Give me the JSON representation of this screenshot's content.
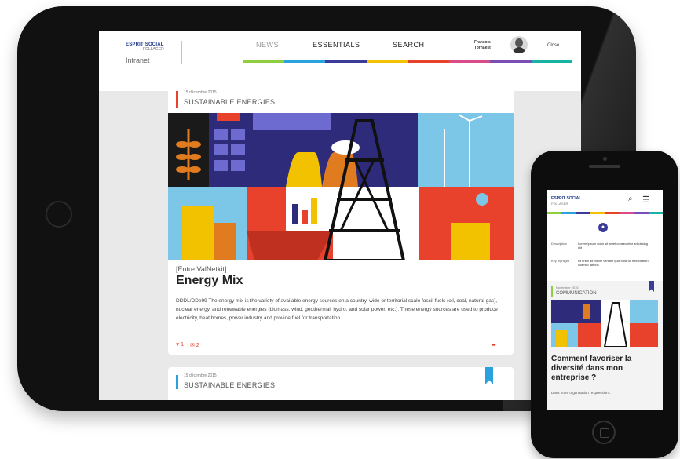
{
  "tablet": {
    "logo": {
      "brand": "ESPRIT SOCIAL",
      "sub": "FOLLAGER",
      "app": "Intranet"
    },
    "nav": {
      "news": "NEWS",
      "essentials": "ESSENTIALS",
      "search": "SEARCH"
    },
    "user": {
      "line1": "François",
      "line2": "Tornaest",
      "menu": "Close"
    },
    "nav_colors": [
      "#8fce3f",
      "#2aa2de",
      "#3b3b9a",
      "#f2c200",
      "#e8412c",
      "#d94c8a",
      "#7a4fb5",
      "#17b3a3"
    ],
    "article": {
      "date": "15 décembre 2015",
      "category": "SUSTAINABLE ENERGIES",
      "tag": "[Entre ValNetkit]",
      "title": "Energy Mix",
      "body": "DDDL/DDe99 The energy mix is the variety of available energy sources on a country, wide or territorial scale fossil fuels (oil, coal, natural gas), nuclear energy, and renewable energies (biomass, wind, geothermal, hydro, and solar power, etc.). These energy sources are used to produce electricity, heat homes, power industry and provide fuel for transportation.",
      "likes": "1",
      "comments": "2"
    },
    "article2": {
      "date": "15 décembre 2015",
      "category": "SUSTAINABLE ENERGIES"
    }
  },
  "phone": {
    "brand": "ESPRIT SOCIAL",
    "sub": "FOLLAGER",
    "rows": [
      {
        "label": "Description",
        "value": "Lorem ipsum dolor sit amet consectetur adipiscing elit"
      },
      {
        "label": "Key highlight",
        "value": "Ut enim ad minim veniam quis nostrud exercitation ullamco laboris"
      }
    ],
    "card": {
      "date": "Novembre 2015",
      "category": "COMMUNICATION",
      "title": "Comment favoriser la diversité dans mon entreprise ?",
      "body": "Dans notre organisation l'expression..."
    }
  }
}
